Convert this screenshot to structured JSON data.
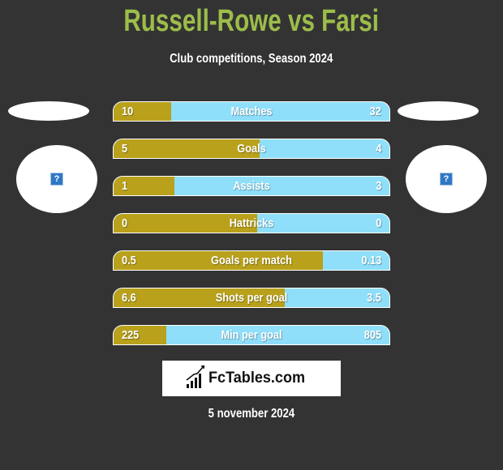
{
  "header": {
    "title": "Russell-Rowe vs Farsi",
    "subtitle": "Club competitions, Season 2024"
  },
  "players": {
    "left": {
      "photo_icon": "missing-image-icon",
      "photo_placeholder": "?"
    },
    "right": {
      "photo_icon": "missing-image-icon",
      "photo_placeholder": "?"
    }
  },
  "stats": [
    {
      "label": "Matches",
      "left": "10",
      "right": "32",
      "left_share": 0.21
    },
    {
      "label": "Goals",
      "left": "5",
      "right": "4",
      "left_share": 0.53
    },
    {
      "label": "Assists",
      "left": "1",
      "right": "3",
      "left_share": 0.22
    },
    {
      "label": "Hattricks",
      "left": "0",
      "right": "0",
      "left_share": 0.52
    },
    {
      "label": "Goals per match",
      "left": "0.5",
      "right": "0.13",
      "left_share": 0.76
    },
    {
      "label": "Shots per goal",
      "left": "6.6",
      "right": "3.5",
      "left_share": 0.62
    },
    {
      "label": "Min per goal",
      "left": "225",
      "right": "805",
      "left_share": 0.19
    }
  ],
  "footer": {
    "logo_text": "FcTables.com",
    "logo_icon": "bar-chart-growth-icon",
    "date": "5 november 2024"
  },
  "colors": {
    "background": "#333333",
    "title": "#9cbd4a",
    "left_bar": "#b9a11b",
    "right_bar": "#8fdffa"
  }
}
